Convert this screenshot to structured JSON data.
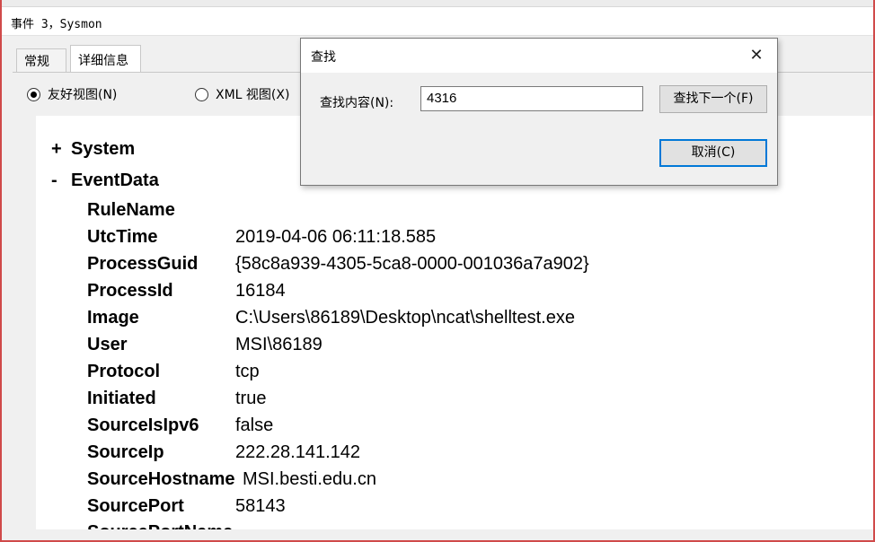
{
  "window": {
    "title": "事件 3，Sysmon"
  },
  "tabs": [
    {
      "label": "常规",
      "active": false
    },
    {
      "label": "详细信息",
      "active": true
    }
  ],
  "view_options": {
    "friendly": {
      "label": "友好视图(N)",
      "checked": true
    },
    "xml": {
      "label": "XML 视图(X)",
      "checked": false
    }
  },
  "tree": {
    "system": {
      "sign": "+",
      "label": "System"
    },
    "eventdata": {
      "sign": "-",
      "label": "EventData"
    }
  },
  "event_data": [
    {
      "key": "RuleName",
      "value": ""
    },
    {
      "key": "UtcTime",
      "value": "2019-04-06 06:11:18.585"
    },
    {
      "key": "ProcessGuid",
      "value": "{58c8a939-4305-5ca8-0000-001036a7a902}"
    },
    {
      "key": "ProcessId",
      "value": "16184"
    },
    {
      "key": "Image",
      "value": "C:\\Users\\86189\\Desktop\\ncat\\shelltest.exe"
    },
    {
      "key": "User",
      "value": "MSI\\86189"
    },
    {
      "key": "Protocol",
      "value": "tcp"
    },
    {
      "key": "Initiated",
      "value": "true"
    },
    {
      "key": "SourceIsIpv6",
      "value": "false"
    },
    {
      "key": "SourceIp",
      "value": "222.28.141.142"
    },
    {
      "key": "SourceHostname",
      "value": "MSI.besti.edu.cn"
    },
    {
      "key": "SourcePort",
      "value": "58143"
    },
    {
      "key": "SourcePortName",
      "value": ""
    }
  ],
  "find_dialog": {
    "title": "查找",
    "close_icon": "close-icon",
    "label": "查找内容(N):",
    "value": "4316",
    "find_next_label": "查找下一个(F)",
    "cancel_label": "取消(C)"
  }
}
